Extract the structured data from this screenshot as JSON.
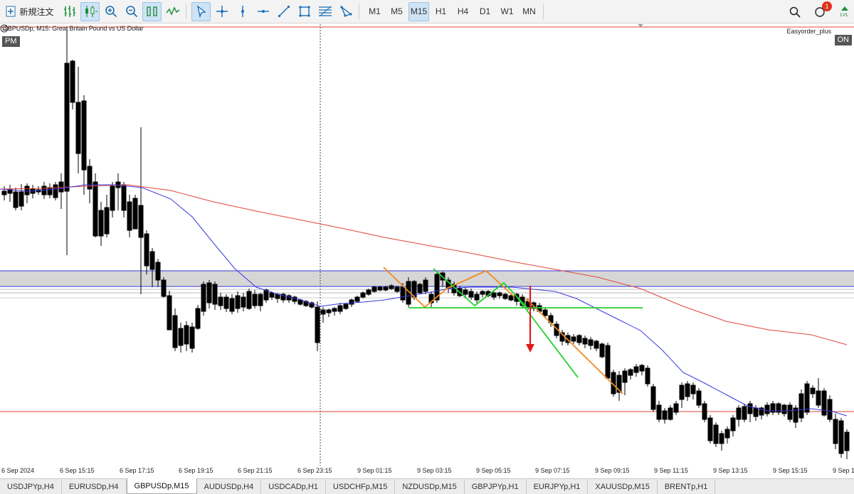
{
  "toolbar": {
    "new_order_label": "新規注文",
    "timeframes": [
      "M1",
      "M5",
      "M15",
      "H1",
      "H4",
      "D1",
      "W1",
      "MN"
    ],
    "active_timeframe": "M15",
    "notification_count": "1",
    "lvl_label": "LVL"
  },
  "chart": {
    "title": "GBPUSDp, M15:  Great Britain Pound vs US Dollar",
    "left_tag": "PM",
    "ea_name": "Easyorder_plus",
    "ea_status": "ON",
    "colors": {
      "bull_candle": "#ffffff",
      "bear_candle": "#000000",
      "ma_fast": "#3a3adf",
      "ma_slow": "#e0463a",
      "orange_pattern": "#f08a1e",
      "green_pattern": "#22d12a",
      "arrow": "#e01b1b"
    }
  },
  "time_axis": {
    "labels": [
      "6 Sep 2024",
      "6 Sep 15:15",
      "6 Sep 17:15",
      "6 Sep 19:15",
      "6 Sep 21:15",
      "6 Sep 23:15",
      "9 Sep 01:15",
      "9 Sep 03:15",
      "9 Sep 05:15",
      "9 Sep 07:15",
      "9 Sep 09:15",
      "9 Sep 11:15",
      "9 Sep 13:15",
      "9 Sep 15:15",
      "9 Sep 1"
    ]
  },
  "tabs": [
    {
      "label": "USDJPYp,H4",
      "active": false
    },
    {
      "label": "EURUSDp,H4",
      "active": false
    },
    {
      "label": "GBPUSDp,M15",
      "active": true
    },
    {
      "label": "AUDUSDp,H4",
      "active": false
    },
    {
      "label": "USDCADp,H1",
      "active": false
    },
    {
      "label": "USDCHFp,M15",
      "active": false
    },
    {
      "label": "NZDUSDp,M15",
      "active": false
    },
    {
      "label": "GBPJPYp,H1",
      "active": false
    },
    {
      "label": "EURJPYp,H1",
      "active": false
    },
    {
      "label": "XAUUSDp,M15",
      "active": false
    },
    {
      "label": "BRENTp,H1",
      "active": false
    }
  ]
}
